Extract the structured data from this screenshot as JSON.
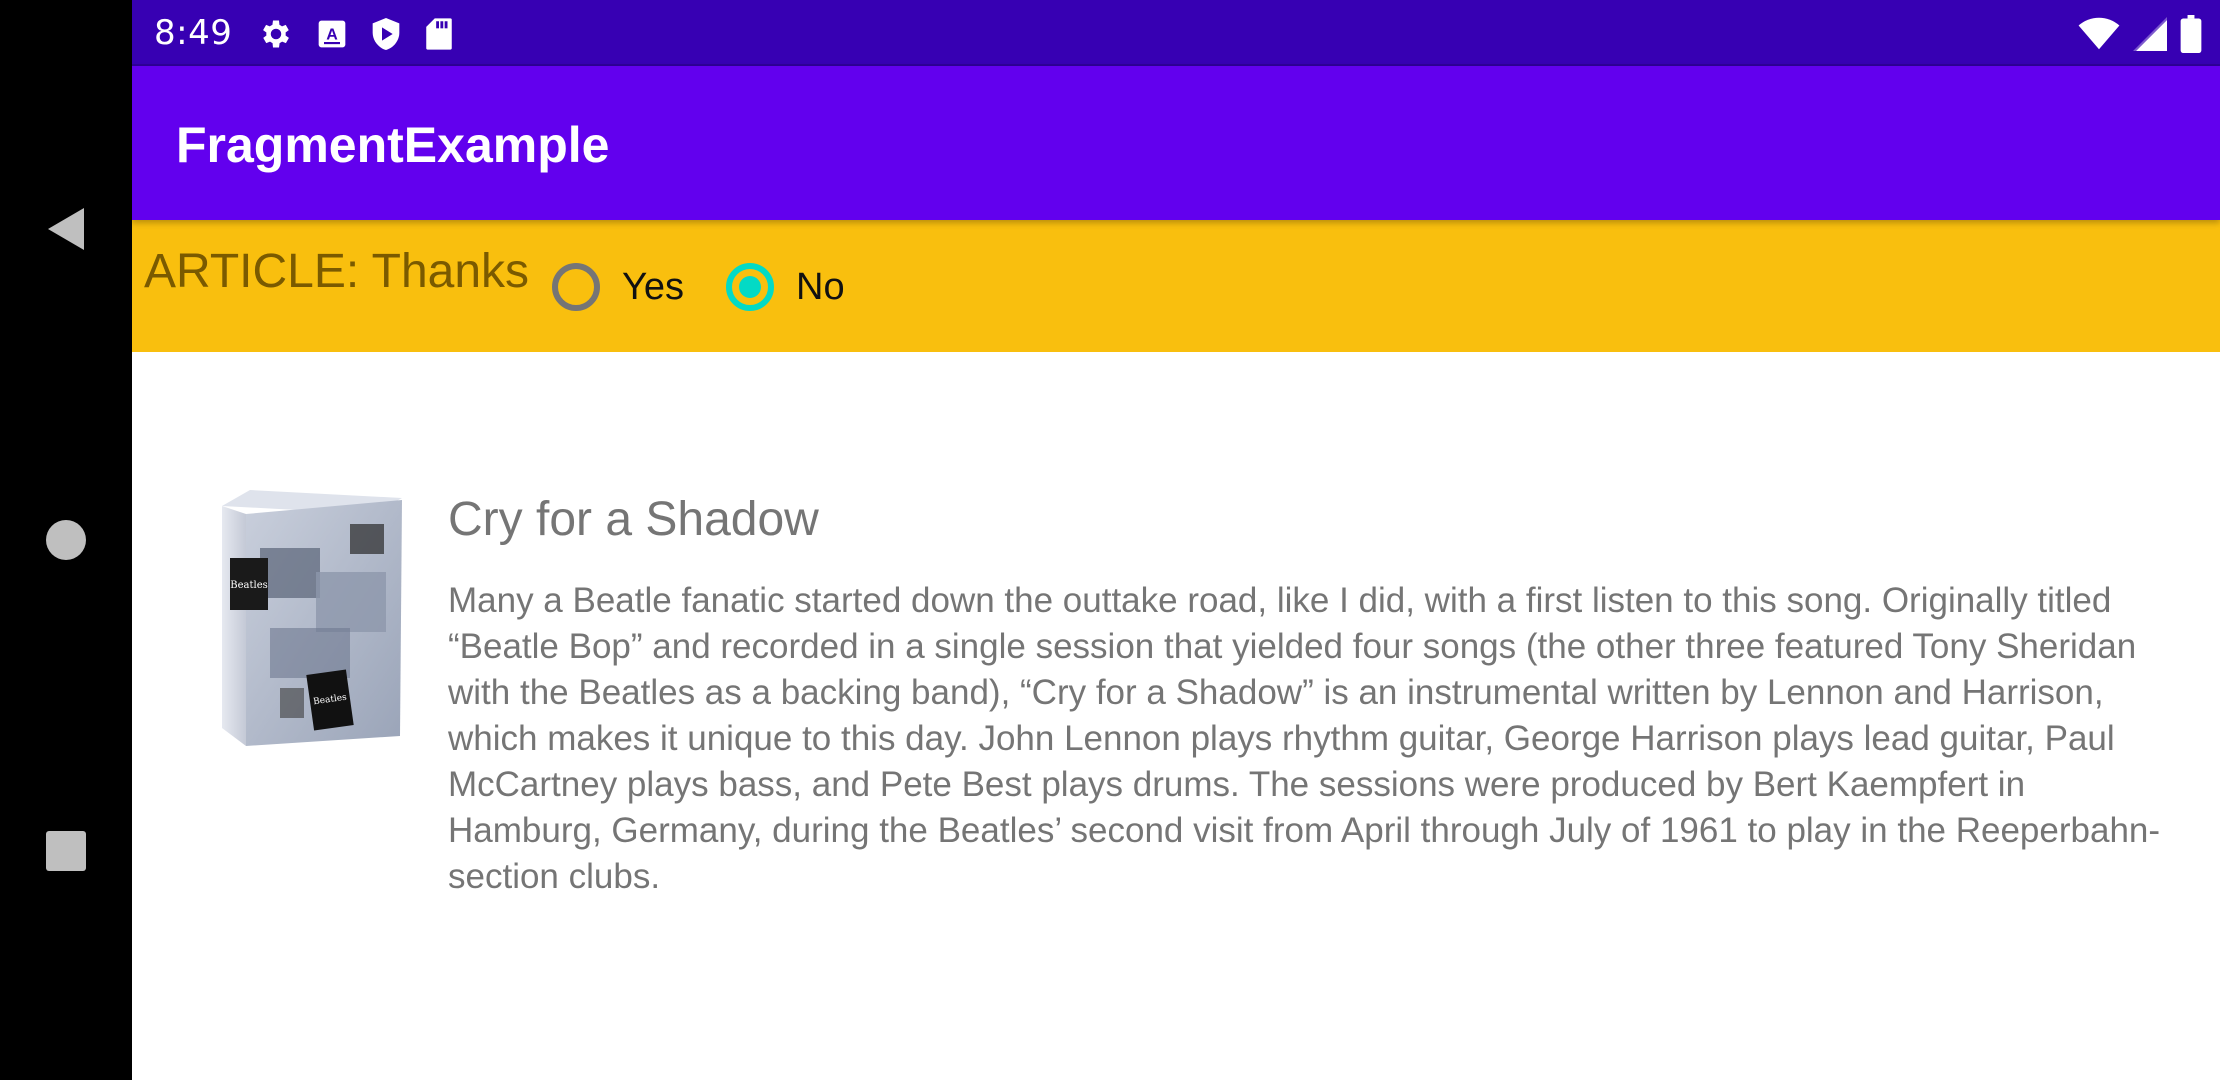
{
  "status_bar": {
    "time": "8:49",
    "left_icons": [
      "gear-icon",
      "font-a-icon",
      "shield-play-icon",
      "sd-card-icon"
    ],
    "right_icons": [
      "wifi-icon",
      "signal-icon",
      "battery-icon"
    ]
  },
  "app_bar": {
    "title": "FragmentExample"
  },
  "fragment": {
    "label": "ARTICLE: Thanks",
    "options": [
      {
        "label": "Yes",
        "checked": false
      },
      {
        "label": "No",
        "checked": true
      }
    ]
  },
  "article": {
    "image_icon": "album-box-set-image",
    "title": "Cry for a Shadow",
    "body": "Many a Beatle fanatic started down the outtake road, like I did, with a first listen to this song. Originally titled “Beatle Bop” and recorded in a single session that yielded four songs (the other three featured Tony Sheridan with the Beatles as a backing band), “Cry for a Shadow” is an instrumental written by Lennon and Harrison, which makes it unique to this day. John Lennon plays rhythm guitar, George Harrison plays lead guitar, Paul McCartney plays bass, and Pete Best plays drums. The sessions were produced by Bert Kaempfert in Hamburg, Germany, during the Beatles’ second visit from April through July of 1961 to play in the Reeperbahn-section clubs."
  },
  "navigation": {
    "icons": [
      "back-icon",
      "home-icon",
      "recents-icon"
    ]
  },
  "colors": {
    "status_bar": "#3700b3",
    "app_bar": "#6200ee",
    "fragment_strip": "#f9bf0e",
    "radio_accent": "#03dac5",
    "body_text": "#757575"
  }
}
